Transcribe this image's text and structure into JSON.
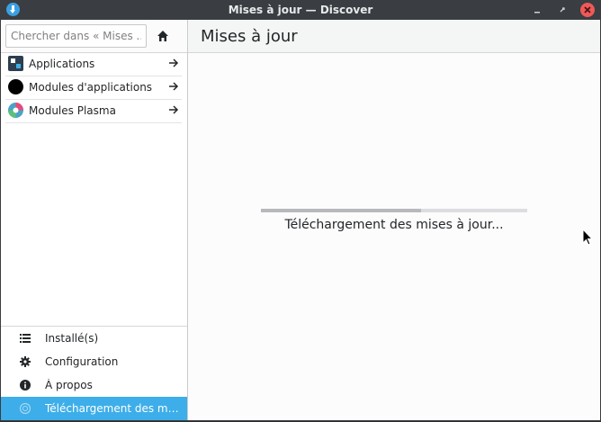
{
  "window": {
    "title": "Mises à jour — Discover",
    "controls": [
      "minimize",
      "restore",
      "close"
    ]
  },
  "sidebar": {
    "search": {
      "placeholder": "Chercher dans « Mises ...",
      "value": ""
    },
    "categories": [
      {
        "label": "Applications",
        "icon": "applications-grid-icon"
      },
      {
        "label": "Modules d'applications",
        "icon": "addons-circle-icon"
      },
      {
        "label": "Modules Plasma",
        "icon": "plasma-icon"
      }
    ],
    "bottom_nav": [
      {
        "label": "Installé(s)",
        "icon": "list-icon",
        "active": false
      },
      {
        "label": "Configuration",
        "icon": "gear-icon",
        "active": false
      },
      {
        "label": "À propos",
        "icon": "info-icon",
        "active": false
      },
      {
        "label": "Téléchargement des mi...",
        "icon": "update-icon",
        "active": true
      }
    ]
  },
  "main": {
    "title": "Mises à jour",
    "progress": {
      "value": 0.6
    },
    "status_text": "Téléchargement des mises à jour..."
  },
  "colors": {
    "accent": "#3daee9",
    "titlebar": "#3a3d42",
    "close_button": "#ed5a58"
  }
}
